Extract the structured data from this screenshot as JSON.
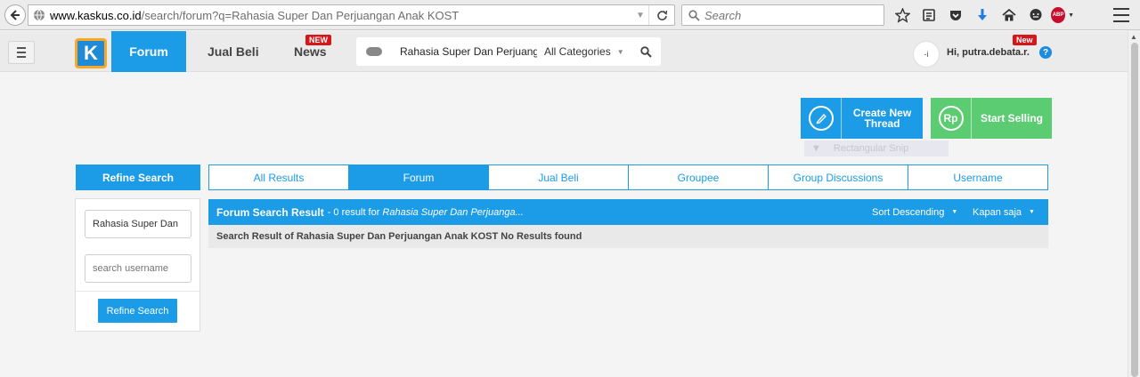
{
  "browser": {
    "url_host": "www.kaskus.co.id",
    "url_path": "/search/forum?q=Rahasia Super Dan Perjuangan Anak KOST",
    "search_placeholder": "Search",
    "adblock_label": "ABP"
  },
  "header": {
    "logo_text": "K",
    "nav": {
      "forum": "Forum",
      "jual_beli": "Jual Beli",
      "news": "News"
    },
    "news_badge": "NEW",
    "search_query": "Rahasia Super Dan Perjuang",
    "category": "All Categories",
    "avatar_text": "-i",
    "user_badge": "New",
    "user_greeting": "Hi, putra.debata.r.",
    "help": "?"
  },
  "actions": {
    "create_line1": "Create New",
    "create_line2": "Thread",
    "sell_icon_text": "Rp",
    "sell_label": "Start Selling",
    "tooltip_text": "Rectangular Snip"
  },
  "refine": {
    "title": "Refine Search",
    "query_value": "Rahasia Super Dan",
    "username_placeholder": "search username",
    "button": "Refine Search"
  },
  "tabs": [
    {
      "label": "All Results",
      "active": false
    },
    {
      "label": "Forum",
      "active": true
    },
    {
      "label": "Jual Beli",
      "active": false
    },
    {
      "label": "Groupee",
      "active": false
    },
    {
      "label": "Group Discussions",
      "active": false
    },
    {
      "label": "Username",
      "active": false
    }
  ],
  "results": {
    "title": "Forum Search Result",
    "count_text": "- 0 result for",
    "query": "Rahasia Super Dan Perjuanga...",
    "sort": "Sort Descending",
    "time": "Kapan saja",
    "message": "Search Result of Rahasia Super Dan Perjuangan Anak KOST No Results found"
  },
  "colors": {
    "primary": "#1c9be7",
    "sell": "#5ccc72",
    "badge": "#d7161c"
  }
}
